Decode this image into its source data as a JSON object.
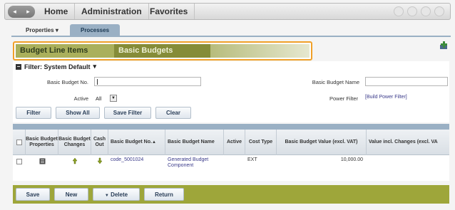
{
  "nav": {
    "home": "Home",
    "administration": "Administration",
    "favorites": "Favorites"
  },
  "tabs": {
    "properties": "Properties",
    "properties_caret": "▾",
    "processes": "Processes"
  },
  "banner": {
    "item1": "Budget Line Items",
    "item2": "Basic Budgets"
  },
  "filter": {
    "header": "Filter: System Default",
    "header_caret": "▾",
    "no_label": "Basic Budget No.",
    "name_label": "Basic Budget Name",
    "active_label": "Active",
    "active_value": "All",
    "power_label": "Power Filter",
    "power_link": "[Build Power Filter]",
    "buttons": {
      "filter": "Filter",
      "show_all": "Show All",
      "save_filter": "Save Filter",
      "clear": "Clear"
    }
  },
  "grid": {
    "headers": {
      "properties": "Basic Budget Properties",
      "changes": "Basic Budget Changes",
      "cashout": "Cash Out",
      "no": "Basic Budget No.",
      "no_sort": "▲",
      "name": "Basic Budget Name",
      "active": "Active",
      "cost_type": "Cost Type",
      "value": "Basic Budget Value (excl. VAT)",
      "incl_changes": "Value incl. Changes (excl. VA"
    },
    "rows": [
      {
        "no": "code_5001024",
        "name": "Generated Budget Component",
        "active": "",
        "cost_type": "EXT",
        "value": "10,000.00",
        "incl_changes": ""
      }
    ]
  },
  "bottom": {
    "save": "Save",
    "new": "New",
    "delete": "Delete",
    "return": "Return"
  },
  "colors": {
    "olive": "#9ea63a",
    "steel": "#9ab0c4",
    "highlight": "#f0a028"
  }
}
